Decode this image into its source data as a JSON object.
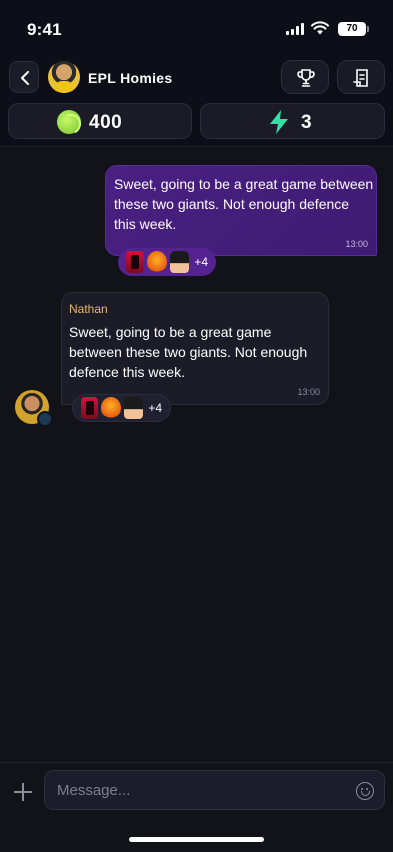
{
  "status_bar": {
    "time": "9:41",
    "battery": "70"
  },
  "header": {
    "group_name": "EPL Homies"
  },
  "stats": {
    "coins": "400",
    "bolts": "3"
  },
  "messages": [
    {
      "direction": "outgoing",
      "text": "Sweet, going to be a great game between these two giants. Not enough defence this week.",
      "time": "13:00",
      "reactions_more": "+4"
    },
    {
      "direction": "incoming",
      "sender": "Nathan",
      "text": "Sweet, going to be a great game between these two giants. Not enough defence this week.",
      "time": "13:00",
      "reactions_more": "+4"
    }
  ],
  "composer": {
    "placeholder": "Message..."
  },
  "colors": {
    "accent_purple": "#4a2083",
    "sender_name": "#e8b96c",
    "bolt": "#2ee3a8",
    "coin": "#8ee03c"
  },
  "icons": [
    "back-icon",
    "trophy-icon",
    "leaderboard-icon",
    "coin-icon",
    "bolt-icon",
    "plus-icon",
    "emoji-icon"
  ]
}
